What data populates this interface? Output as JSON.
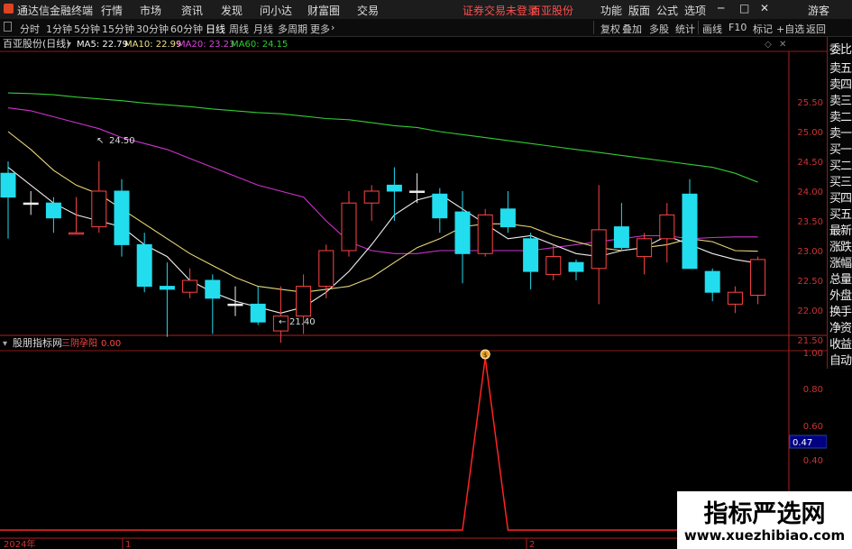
{
  "app": {
    "title": "通达信金融终端",
    "login_status": "证券交易未登录",
    "stock_name": "百亚股份",
    "guest": "游客"
  },
  "menu": [
    "行情",
    "市场",
    "资讯",
    "发现",
    "问小达",
    "财富圈",
    "交易"
  ],
  "menu_right": [
    "功能",
    "版面",
    "公式",
    "选项"
  ],
  "periods": [
    "分时",
    "1分钟",
    "5分钟",
    "15分钟",
    "30分钟",
    "60分钟",
    "日线",
    "周线",
    "月线",
    "多周期",
    "更多"
  ],
  "active_period": "日线",
  "toolbar_right": [
    "复权",
    "叠加",
    "多股",
    "统计",
    "画线",
    "F10",
    "标记",
    "+自选",
    "返回"
  ],
  "main_panel": {
    "title": "百亚股份(日线)",
    "ma": [
      {
        "label": "MA5: 22.79",
        "color": "#f5f5f5"
      },
      {
        "label": "MA10: 22.99",
        "color": "#f0e08a"
      },
      {
        "label": "MA20: 23.23",
        "color": "#dd44dd"
      },
      {
        "label": "MA60: 24.15",
        "color": "#33cc33"
      }
    ],
    "high_label": "24.50",
    "low_label": "21.40"
  },
  "price_axis": [
    "25.50",
    "25.00",
    "24.50",
    "24.00",
    "23.50",
    "23.00",
    "22.50",
    "22.00",
    "21.50"
  ],
  "right_panel": [
    "委比",
    "卖五",
    "卖四",
    "卖三",
    "卖二",
    "卖一",
    "买一",
    "买二",
    "买三",
    "买四",
    "买五",
    "最新",
    "涨跌",
    "涨幅",
    "总量",
    "外盘",
    "换手",
    "净资",
    "收益",
    "自动"
  ],
  "indicator_panel": {
    "title": "股朋指标网",
    "indicator": "三阴孕阳",
    "value": "0.00",
    "current_value": "0.47",
    "axis": [
      "1.00",
      "0.80",
      "0.60",
      "0.40"
    ],
    "values": [
      0,
      0,
      0,
      0,
      0,
      0,
      0,
      0,
      0,
      0,
      0,
      0,
      0,
      0,
      0,
      0,
      0,
      0,
      0,
      0,
      0,
      1,
      0,
      0,
      0,
      0,
      0,
      0,
      0,
      0,
      0,
      0,
      0,
      0,
      0
    ]
  },
  "x_axis": {
    "year": "2024年",
    "marks": [
      "1",
      "2"
    ]
  },
  "watermark": {
    "cn": "指标严选网",
    "url": "www.xuezhibiao.com"
  },
  "colors": {
    "up": "#ff4444",
    "down": "#22ddee",
    "axis": "#b02020",
    "bg": "#000000"
  },
  "chart_data": {
    "type": "candlestick",
    "ylim": [
      21.2,
      25.8
    ],
    "candles": [
      {
        "o": 23.9,
        "c": 24.3,
        "h": 24.5,
        "l": 23.2,
        "dir": "down"
      },
      {
        "o": 23.8,
        "c": 23.8,
        "h": 24.0,
        "l": 23.6,
        "dir": "flat"
      },
      {
        "o": 23.8,
        "c": 23.55,
        "h": 23.9,
        "l": 23.3,
        "dir": "down"
      },
      {
        "o": 23.3,
        "c": 23.3,
        "h": 23.9,
        "l": 23.3,
        "dir": "up"
      },
      {
        "o": 23.4,
        "c": 24.0,
        "h": 24.5,
        "l": 23.3,
        "dir": "up"
      },
      {
        "o": 24.0,
        "c": 23.1,
        "h": 24.2,
        "l": 22.9,
        "dir": "down"
      },
      {
        "o": 23.1,
        "c": 22.4,
        "h": 23.3,
        "l": 22.3,
        "dir": "down"
      },
      {
        "o": 22.4,
        "c": 22.35,
        "h": 22.8,
        "l": 21.55,
        "dir": "down"
      },
      {
        "o": 22.3,
        "c": 22.5,
        "h": 22.7,
        "l": 22.2,
        "dir": "up"
      },
      {
        "o": 22.5,
        "c": 22.2,
        "h": 22.6,
        "l": 21.6,
        "dir": "down"
      },
      {
        "o": 22.1,
        "c": 22.1,
        "h": 22.4,
        "l": 21.9,
        "dir": "flat"
      },
      {
        "o": 22.1,
        "c": 21.8,
        "h": 22.4,
        "l": 21.75,
        "dir": "down"
      },
      {
        "o": 21.65,
        "c": 21.9,
        "h": 22.4,
        "l": 21.45,
        "dir": "up"
      },
      {
        "o": 21.9,
        "c": 22.4,
        "h": 22.6,
        "l": 21.6,
        "dir": "up"
      },
      {
        "o": 22.4,
        "c": 23.0,
        "h": 23.1,
        "l": 22.2,
        "dir": "up"
      },
      {
        "o": 23.0,
        "c": 23.8,
        "h": 24.0,
        "l": 22.9,
        "dir": "up"
      },
      {
        "o": 23.8,
        "c": 24.0,
        "h": 24.1,
        "l": 23.5,
        "dir": "up"
      },
      {
        "o": 24.1,
        "c": 24.0,
        "h": 24.4,
        "l": 23.5,
        "dir": "down"
      },
      {
        "o": 24.0,
        "c": 24.0,
        "h": 24.3,
        "l": 23.8,
        "dir": "flat"
      },
      {
        "o": 23.95,
        "c": 23.55,
        "h": 24.05,
        "l": 23.3,
        "dir": "down"
      },
      {
        "o": 23.65,
        "c": 22.95,
        "h": 24.0,
        "l": 22.45,
        "dir": "down"
      },
      {
        "o": 22.95,
        "c": 23.6,
        "h": 23.7,
        "l": 22.9,
        "dir": "up"
      },
      {
        "o": 23.7,
        "c": 23.4,
        "h": 24.0,
        "l": 23.3,
        "dir": "down"
      },
      {
        "o": 23.2,
        "c": 22.65,
        "h": 23.3,
        "l": 22.35,
        "dir": "down"
      },
      {
        "o": 22.9,
        "c": 22.6,
        "h": 23.1,
        "l": 22.5,
        "dir": "up"
      },
      {
        "o": 22.8,
        "c": 22.65,
        "h": 22.85,
        "l": 22.5,
        "dir": "down"
      },
      {
        "o": 22.7,
        "c": 23.35,
        "h": 24.1,
        "l": 22.1,
        "dir": "up"
      },
      {
        "o": 23.4,
        "c": 23.05,
        "h": 23.8,
        "l": 23.0,
        "dir": "down"
      },
      {
        "o": 22.9,
        "c": 23.2,
        "h": 23.3,
        "l": 22.6,
        "dir": "up"
      },
      {
        "o": 23.2,
        "c": 23.6,
        "h": 23.8,
        "l": 22.8,
        "dir": "up"
      },
      {
        "o": 23.95,
        "c": 22.7,
        "h": 24.2,
        "l": 22.7,
        "dir": "down"
      },
      {
        "o": 22.65,
        "c": 22.3,
        "h": 22.7,
        "l": 22.15,
        "dir": "down"
      },
      {
        "o": 22.3,
        "c": 22.1,
        "h": 22.4,
        "l": 21.95,
        "dir": "up"
      },
      {
        "o": 22.25,
        "c": 22.85,
        "h": 22.9,
        "l": 22.1,
        "dir": "up"
      }
    ],
    "ma5": [
      24.4,
      24.1,
      23.8,
      23.6,
      23.5,
      23.4,
      23.1,
      22.9,
      22.5,
      22.3,
      22.15,
      22.05,
      21.95,
      22.05,
      22.3,
      22.65,
      23.1,
      23.6,
      23.85,
      23.95,
      23.7,
      23.45,
      23.2,
      23.25,
      23.1,
      22.95,
      22.9,
      23.0,
      23.05,
      23.25,
      23.1,
      22.95,
      22.85,
      22.79
    ],
    "ma10": [
      25.0,
      24.7,
      24.35,
      24.1,
      23.95,
      23.7,
      23.45,
      23.2,
      22.95,
      22.75,
      22.55,
      22.4,
      22.35,
      22.3,
      22.35,
      22.4,
      22.55,
      22.8,
      23.05,
      23.2,
      23.4,
      23.45,
      23.45,
      23.4,
      23.25,
      23.15,
      23.05,
      23.0,
      23.05,
      23.1,
      23.2,
      23.15,
      23.0,
      22.99
    ],
    "ma20": [
      25.4,
      25.35,
      25.25,
      25.15,
      25.05,
      24.9,
      24.8,
      24.7,
      24.55,
      24.4,
      24.25,
      24.1,
      24.0,
      23.9,
      23.5,
      23.15,
      23.0,
      22.95,
      22.95,
      23.0,
      23.0,
      23.0,
      23.0,
      23.0,
      23.05,
      23.1,
      23.15,
      23.2,
      23.25,
      23.25,
      23.2,
      23.22,
      23.23,
      23.23
    ],
    "ma60": [
      25.65,
      25.64,
      25.62,
      25.58,
      25.55,
      25.52,
      25.48,
      25.45,
      25.42,
      25.38,
      25.35,
      25.32,
      25.3,
      25.26,
      25.22,
      25.2,
      25.15,
      25.1,
      25.07,
      25.0,
      24.95,
      24.9,
      24.85,
      24.8,
      24.75,
      24.7,
      24.65,
      24.6,
      24.55,
      24.5,
      24.45,
      24.4,
      24.3,
      24.15
    ]
  }
}
